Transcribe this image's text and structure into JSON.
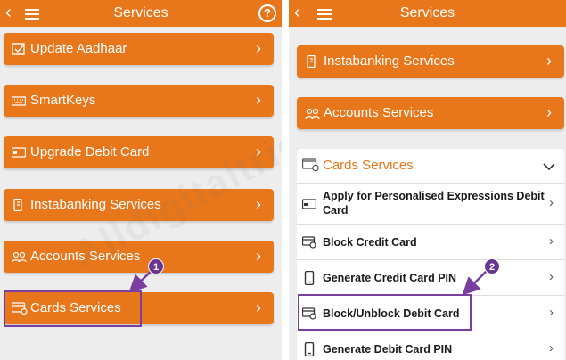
{
  "left": {
    "header": {
      "title": "Services"
    },
    "items": [
      {
        "label": "Update Aadhaar",
        "icon": "form-check-icon"
      },
      {
        "label": "SmartKeys",
        "icon": "keyboard-icon"
      },
      {
        "label": "Upgrade Debit Card",
        "icon": "card-icon"
      },
      {
        "label": "Instabanking Services",
        "icon": "mobile-bank-icon"
      },
      {
        "label": "Accounts Services",
        "icon": "accounts-icon"
      },
      {
        "label": "Cards Services",
        "icon": "cards-gear-icon"
      }
    ]
  },
  "right": {
    "header": {
      "title": "Services"
    },
    "items": [
      {
        "label": "Instabanking Services",
        "icon": "mobile-bank-icon"
      },
      {
        "label": "Accounts Services",
        "icon": "accounts-icon"
      }
    ],
    "cards_section": {
      "title": "Cards Services",
      "items": [
        {
          "label": "Apply for Personalised Expressions Debit Card",
          "icon": "card-icon"
        },
        {
          "label": "Block Credit Card",
          "icon": "card-block-icon"
        },
        {
          "label": "Generate Credit Card PIN",
          "icon": "phone-icon"
        },
        {
          "label": "Block/Unblock Debit Card",
          "icon": "card-block-icon"
        },
        {
          "label": "Generate Debit Card PIN",
          "icon": "phone-icon"
        }
      ]
    }
  },
  "annotations": {
    "step1": "1",
    "step2": "2"
  },
  "watermark": "Alldigitaltricks.com",
  "colors": {
    "accent": "#e8761b",
    "highlight": "#7a3f9e",
    "background": "#ededed"
  }
}
